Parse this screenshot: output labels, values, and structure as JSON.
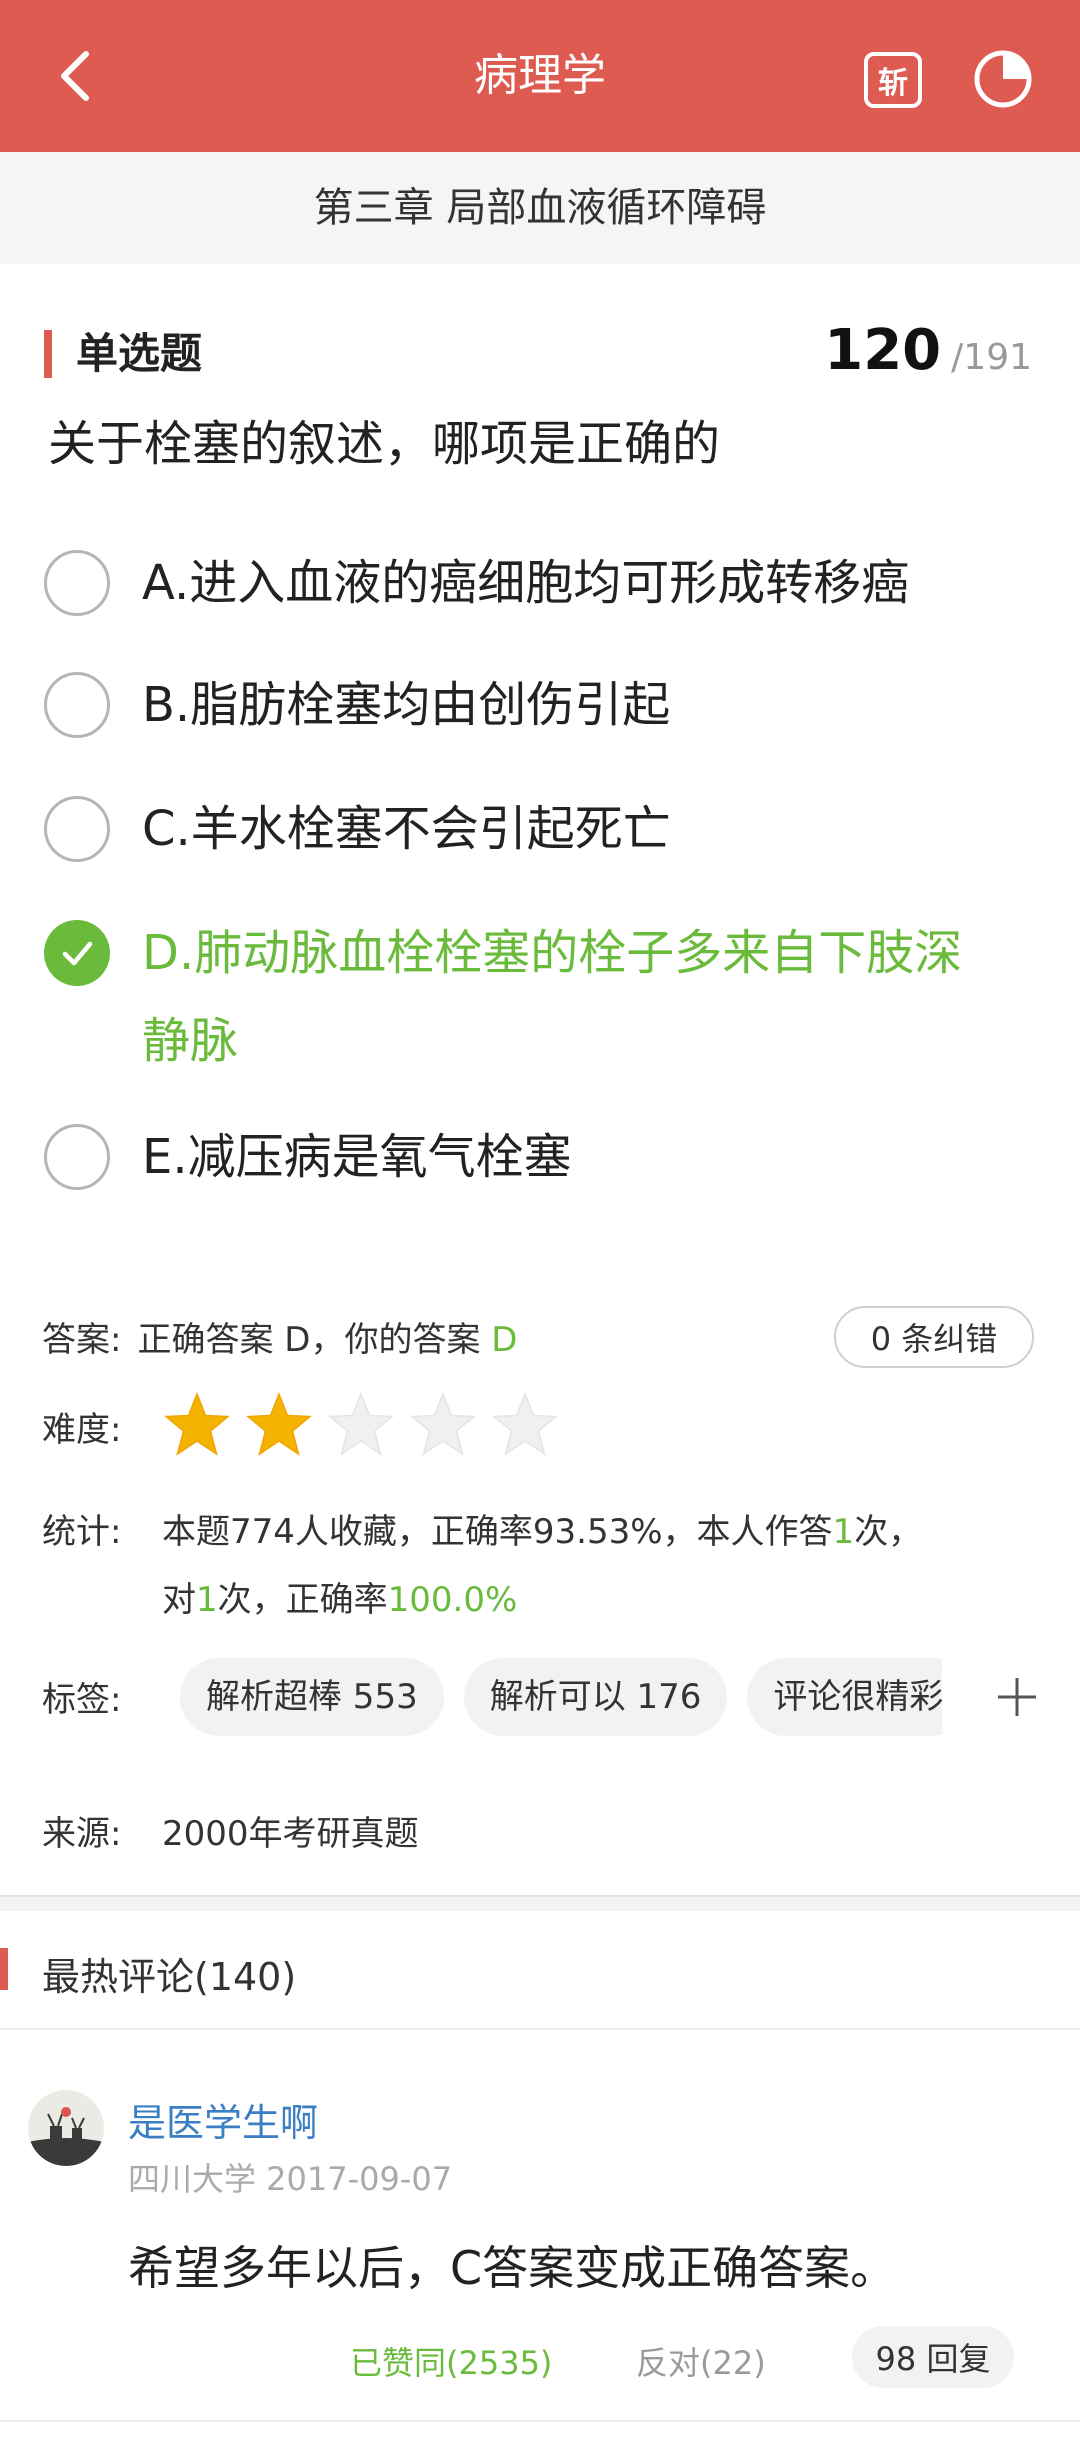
{
  "header": {
    "title": "病理学",
    "slash_icon_text": "斩"
  },
  "chapter": "第三章 局部血液循环障碍",
  "question": {
    "type": "单选题",
    "current": "120",
    "total": "/191",
    "stem": "关于栓塞的叙述，哪项是正确的",
    "options": [
      {
        "text": "A.进入血液的癌细胞均可形成转移癌"
      },
      {
        "text": "B.脂肪栓塞均由创伤引起"
      },
      {
        "text": "C.羊水栓塞不会引起死亡"
      },
      {
        "text_line1": "D.肺动脉血栓栓塞的栓子多来自下肢深",
        "text_line2": "静脉"
      },
      {
        "text": "E.减压病是氧气栓塞"
      }
    ]
  },
  "answer": {
    "label": "答案:",
    "text": "正确答案 D，你的答案 ",
    "user_answer": "D",
    "corrections": "0 条纠错"
  },
  "difficulty": {
    "label": "难度:",
    "filled": 2,
    "max": 5,
    "star_color": "#f5b301"
  },
  "stats": {
    "label": "统计:",
    "line1_a": "本题774人收藏，正确率93.53%，本人作答",
    "line1_b": "1",
    "line1_c": "次，",
    "line2_a": "对",
    "line2_b": "1",
    "line2_c": "次，正确率",
    "line2_d": "100.0%"
  },
  "tags": {
    "label": "标签:",
    "items": [
      "解析超棒 553",
      "解析可以 176",
      "评论很精彩"
    ]
  },
  "source": {
    "label": "来源:",
    "value": "2000年考研真题"
  },
  "comments_section": {
    "title": "最热评论(140)"
  },
  "comment": {
    "user": "是医学生啊",
    "meta": "四川大学 2017-09-07",
    "body": "希望多年以后，C答案变成正确答案。",
    "agree": "已赞同(2535)",
    "oppose": "反对(22)",
    "replies": "98 回复"
  },
  "colors": {
    "header": "#de5b52",
    "correct": "#6aba3c",
    "link": "#3a7ec4"
  }
}
